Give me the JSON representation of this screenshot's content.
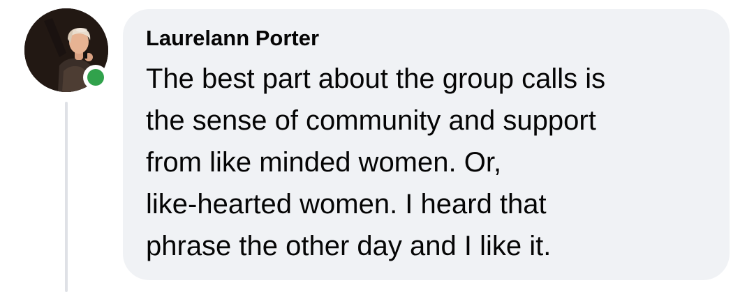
{
  "comment": {
    "author_name": "Laurelann Porter",
    "text": "The best part about the group calls is\nthe sense of community and support\nfrom like minded women. Or,\nlike-hearted women.  I heard that\nphrase the other day and I like it.",
    "online_status": "online",
    "avatar_icon": "profile-photo",
    "colors": {
      "bubble_background": "#f0f2f5",
      "text": "#050505",
      "online_indicator": "#31a24c",
      "thread_line": "#dfe1e6"
    }
  }
}
